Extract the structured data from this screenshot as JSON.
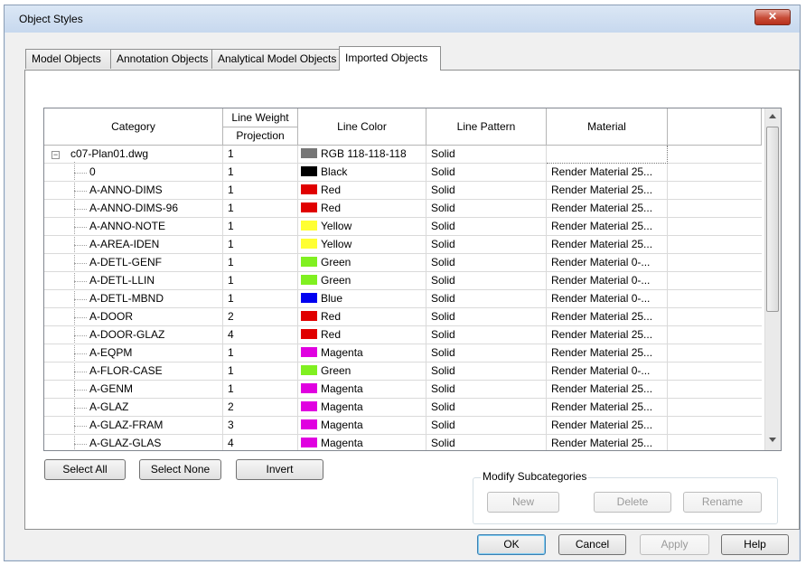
{
  "window": {
    "title": "Object Styles",
    "close_glyph": "✕"
  },
  "tabs": [
    {
      "label": "Model Objects",
      "active": false
    },
    {
      "label": "Annotation Objects",
      "active": false
    },
    {
      "label": "Analytical Model Objects",
      "active": false
    },
    {
      "label": "Imported Objects",
      "active": true
    }
  ],
  "grid": {
    "headers": {
      "category": "Category",
      "line_weight": "Line Weight",
      "projection": "Projection",
      "line_color": "Line Color",
      "line_pattern": "Line Pattern",
      "material": "Material"
    },
    "rows": [
      {
        "category": "c07-Plan01.dwg",
        "weight": "1",
        "color": "RGB 118-118-118",
        "swatch": "#767676",
        "pattern": "Solid",
        "material": "",
        "parent": true
      },
      {
        "category": "0",
        "weight": "1",
        "color": "Black",
        "swatch": "#000000",
        "pattern": "Solid",
        "material": "Render Material 25..."
      },
      {
        "category": "A-ANNO-DIMS",
        "weight": "1",
        "color": "Red",
        "swatch": "#e00000",
        "pattern": "Solid",
        "material": "Render Material 25..."
      },
      {
        "category": "A-ANNO-DIMS-96",
        "weight": "1",
        "color": "Red",
        "swatch": "#e00000",
        "pattern": "Solid",
        "material": "Render Material 25..."
      },
      {
        "category": "A-ANNO-NOTE",
        "weight": "1",
        "color": "Yellow",
        "swatch": "#ffff33",
        "pattern": "Solid",
        "material": "Render Material 25..."
      },
      {
        "category": "A-AREA-IDEN",
        "weight": "1",
        "color": "Yellow",
        "swatch": "#ffff33",
        "pattern": "Solid",
        "material": "Render Material 25..."
      },
      {
        "category": "A-DETL-GENF",
        "weight": "1",
        "color": "Green",
        "swatch": "#80f020",
        "pattern": "Solid",
        "material": "Render Material 0-..."
      },
      {
        "category": "A-DETL-LLIN",
        "weight": "1",
        "color": "Green",
        "swatch": "#80f020",
        "pattern": "Solid",
        "material": "Render Material 0-..."
      },
      {
        "category": "A-DETL-MBND",
        "weight": "1",
        "color": "Blue",
        "swatch": "#0000f0",
        "pattern": "Solid",
        "material": "Render Material 0-..."
      },
      {
        "category": "A-DOOR",
        "weight": "2",
        "color": "Red",
        "swatch": "#e00000",
        "pattern": "Solid",
        "material": "Render Material 25..."
      },
      {
        "category": "A-DOOR-GLAZ",
        "weight": "4",
        "color": "Red",
        "swatch": "#e00000",
        "pattern": "Solid",
        "material": "Render Material 25..."
      },
      {
        "category": "A-EQPM",
        "weight": "1",
        "color": "Magenta",
        "swatch": "#e000e0",
        "pattern": "Solid",
        "material": "Render Material 25..."
      },
      {
        "category": "A-FLOR-CASE",
        "weight": "1",
        "color": "Green",
        "swatch": "#80f020",
        "pattern": "Solid",
        "material": "Render Material 0-..."
      },
      {
        "category": "A-GENM",
        "weight": "1",
        "color": "Magenta",
        "swatch": "#e000e0",
        "pattern": "Solid",
        "material": "Render Material 25..."
      },
      {
        "category": "A-GLAZ",
        "weight": "2",
        "color": "Magenta",
        "swatch": "#e000e0",
        "pattern": "Solid",
        "material": "Render Material 25..."
      },
      {
        "category": "A-GLAZ-FRAM",
        "weight": "3",
        "color": "Magenta",
        "swatch": "#e000e0",
        "pattern": "Solid",
        "material": "Render Material 25..."
      },
      {
        "category": "A-GLAZ-GLAS",
        "weight": "4",
        "color": "Magenta",
        "swatch": "#e000e0",
        "pattern": "Solid",
        "material": "Render Material 25..."
      }
    ]
  },
  "selection_buttons": {
    "select_all": "Select All",
    "select_none": "Select None",
    "invert": "Invert"
  },
  "modify": {
    "label": "Modify Subcategories",
    "new": "New",
    "delete": "Delete",
    "rename": "Rename"
  },
  "footer": {
    "ok": "OK",
    "cancel": "Cancel",
    "apply": "Apply",
    "help": "Help"
  }
}
